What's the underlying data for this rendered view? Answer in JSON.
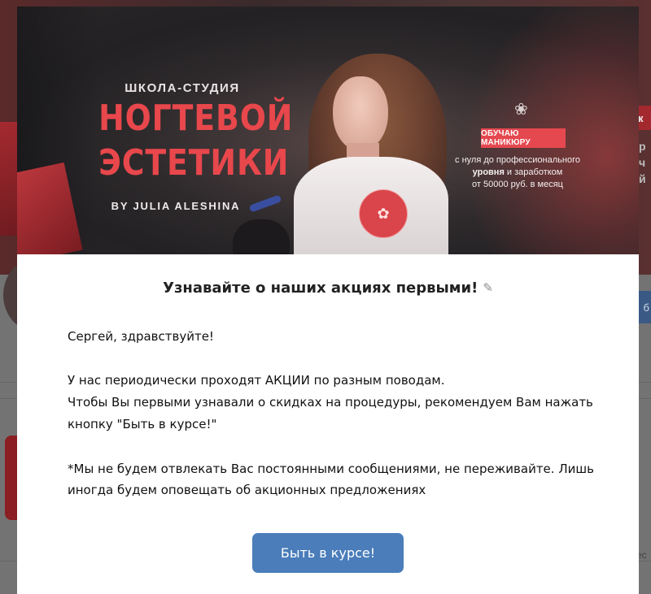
{
  "banner": {
    "school_label": "ШКОЛА-СТУДИЯ",
    "brand_line_1": "НОГТЕВОЙ",
    "brand_line_2": "ЭСТЕТИКИ",
    "by_label": "BY JULIA ALESHINA",
    "offer_badge": "ОБУЧАЮ МАНИКЮРУ",
    "offer_line_1": "с нуля до профессионального",
    "offer_line_2_bold": "уровня",
    "offer_line_2_rest": " и заработком",
    "offer_line_3": "от 50000 руб. в месяц"
  },
  "dialog": {
    "title": "Узнавайте о наших акциях первыми!",
    "greeting": "Сергей, здравствуйте!",
    "line_1": "У нас периодически проходят АКЦИИ по разным поводам.",
    "line_2": "Чтобы Вы первыми узнавали о скидках на процедуры, рекомендуем Вам нажать",
    "line_3": "кнопку \"Быть в курсе!\"",
    "note_1": "*Мы не будем отвлекать Вас постоянными сообщениями, не переживайте. Лишь",
    "note_2": "иногда будем оповещать об акционных предложениях",
    "cta_label": "Быть в курсе!"
  },
  "icons": {
    "edit": "pencil-icon",
    "logo": "flower-logo-icon"
  },
  "colors": {
    "brand_red": "#e8474c",
    "button_blue": "#4a7dba"
  }
}
